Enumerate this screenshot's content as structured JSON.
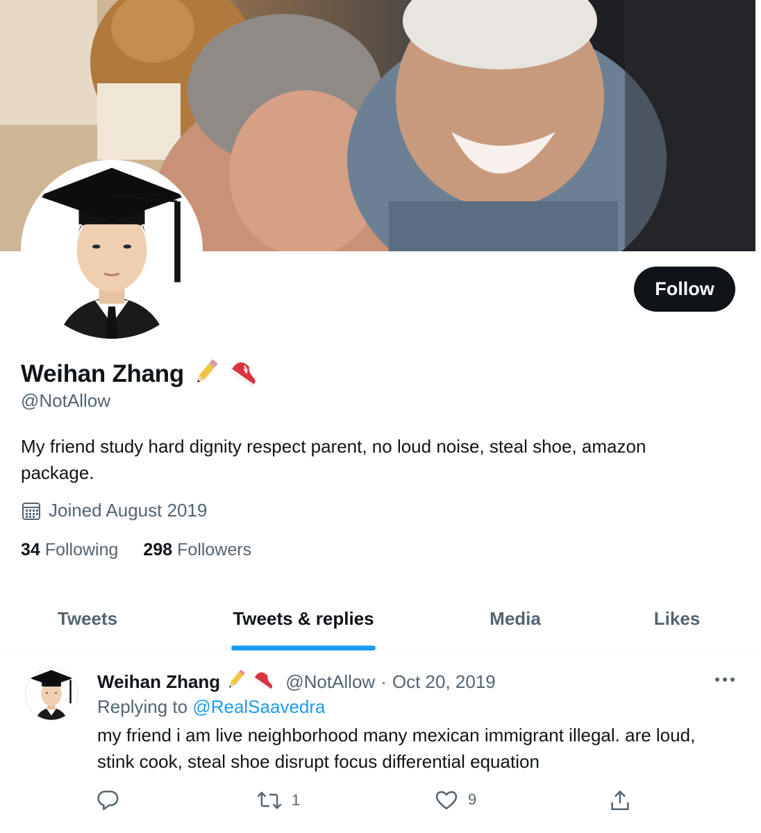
{
  "profile": {
    "display_name": "Weihan Zhang",
    "name_emojis": [
      "pencil-emoji",
      "sneaker-emoji"
    ],
    "handle": "@NotAllow",
    "bio": "My friend study hard dignity respect parent, no loud noise, steal shoe, amazon package.",
    "joined": "Joined August 2019",
    "following_count": "34",
    "following_label": "Following",
    "followers_count": "298",
    "followers_label": "Followers",
    "follow_label": "Follow"
  },
  "tabs": [
    {
      "label": "Tweets",
      "active": false
    },
    {
      "label": "Tweets & replies",
      "active": true
    },
    {
      "label": "Media",
      "active": false
    },
    {
      "label": "Likes",
      "active": false
    }
  ],
  "tweet": {
    "author_name": "Weihan Zhang",
    "author_handle": "@NotAllow",
    "separator": "·",
    "date": "Oct 20, 2019",
    "replying_prefix": "Replying to",
    "replying_to": "@RealSaavedra",
    "text": "my friend i am live neighborhood many mexican immigrant illegal. are loud, stink cook, steal shoe disrupt focus differential equation",
    "reply_count": "",
    "retweet_count": "1",
    "like_count": "9"
  },
  "colors": {
    "accent": "#1d9bf0",
    "text_primary": "#0f1419",
    "text_secondary": "#536471",
    "follow_button": "#0f1419"
  },
  "icons": [
    "calendar-icon",
    "more-icon",
    "reply-icon",
    "retweet-icon",
    "like-icon",
    "share-icon"
  ]
}
